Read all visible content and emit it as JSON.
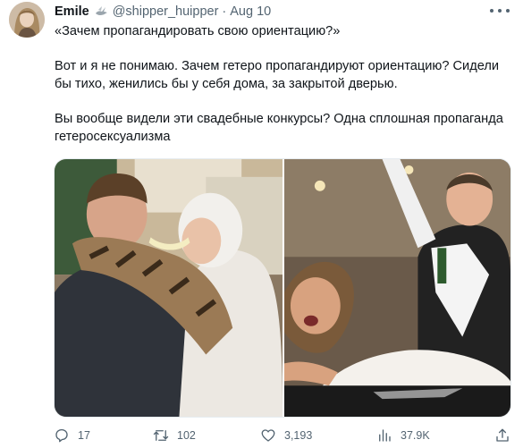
{
  "author": {
    "name": "Emile",
    "handle": "@shipper_huipper",
    "separator": "·",
    "date": "Aug 10"
  },
  "tweet": {
    "paragraphs": [
      "«Зачем пропагандировать свою ориентацию?»",
      "Вот и я не понимаю. Зачем гетеро пропагандируют ориентацию? Сидели бы тихо, женились бы у себя дома, за закрытой дверью.",
      "Вы вообще видели эти свадебные конкурсы? Одна сплошная пропаганда гетеросексуализма"
    ]
  },
  "icons": {
    "badge": "dove-icon",
    "more": "more-icon",
    "reply": "reply-icon",
    "retweet": "retweet-icon",
    "like": "heart-icon",
    "views": "views-icon",
    "share": "share-icon"
  },
  "stats": {
    "replies": "17",
    "retweets": "102",
    "likes": "3,193",
    "views": "37.9K"
  },
  "colors": {
    "text": "#0f1419",
    "secondary": "#536471"
  }
}
